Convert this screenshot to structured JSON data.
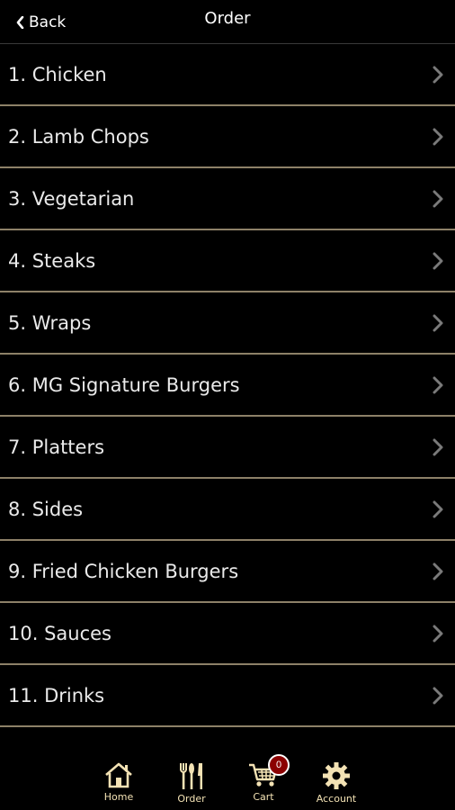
{
  "header": {
    "back_label": "Back",
    "title": "Order"
  },
  "menu": {
    "items": [
      {
        "label": "1. Chicken"
      },
      {
        "label": "2. Lamb Chops"
      },
      {
        "label": "3. Vegetarian"
      },
      {
        "label": "4. Steaks"
      },
      {
        "label": "5. Wraps"
      },
      {
        "label": "6. MG Signature Burgers"
      },
      {
        "label": "7. Platters"
      },
      {
        "label": "8. Sides"
      },
      {
        "label": "9. Fried Chicken Burgers"
      },
      {
        "label": "10. Sauces"
      },
      {
        "label": "11. Drinks"
      }
    ]
  },
  "tabbar": {
    "home_label": "Home",
    "order_label": "Order",
    "cart_label": "Cart",
    "cart_count": "0",
    "account_label": "Account",
    "icon_color": "#f3e2b4",
    "badge_color": "#8b0000"
  },
  "colors": {
    "background": "#000000",
    "divider": "#8d8168",
    "text": "#eaeaea",
    "chevron": "#7a7a7a"
  }
}
